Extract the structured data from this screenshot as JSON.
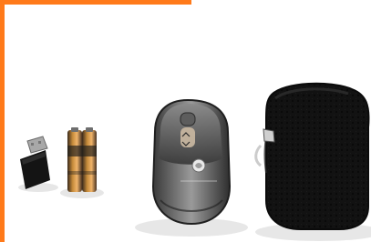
{
  "scene": {
    "description_free": true,
    "colors": {
      "accent_orange": "#ff7a1a",
      "background": "#ffffff",
      "mouse_dark": "#2d2d2d",
      "mouse_light": "#8a8a8a",
      "case_black": "#121212",
      "battery_gold": "#c58a3a"
    },
    "objects": [
      {
        "name": "usb-receiver"
      },
      {
        "name": "aa-batteries"
      },
      {
        "name": "wireless-mouse"
      },
      {
        "name": "carry-case"
      }
    ]
  }
}
